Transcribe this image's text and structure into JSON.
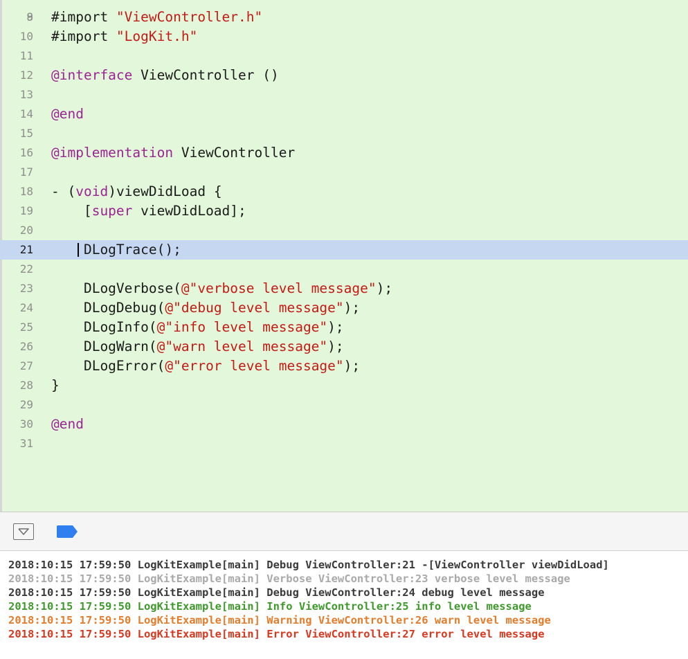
{
  "editor": {
    "top_partial_line_number": "8",
    "lines": [
      {
        "num": "9",
        "parts": [
          {
            "t": "#import ",
            "c": ""
          },
          {
            "t": "\"ViewController.h\"",
            "c": "str"
          }
        ]
      },
      {
        "num": "10",
        "parts": [
          {
            "t": "#import ",
            "c": ""
          },
          {
            "t": "\"LogKit.h\"",
            "c": "str"
          }
        ]
      },
      {
        "num": "11",
        "parts": []
      },
      {
        "num": "12",
        "parts": [
          {
            "t": "@interface",
            "c": "kw"
          },
          {
            "t": " ViewController ()",
            "c": ""
          }
        ]
      },
      {
        "num": "13",
        "parts": []
      },
      {
        "num": "14",
        "parts": [
          {
            "t": "@end",
            "c": "kw"
          }
        ]
      },
      {
        "num": "15",
        "parts": []
      },
      {
        "num": "16",
        "parts": [
          {
            "t": "@implementation",
            "c": "kw"
          },
          {
            "t": " ViewController",
            "c": ""
          }
        ]
      },
      {
        "num": "17",
        "parts": []
      },
      {
        "num": "18",
        "parts": [
          {
            "t": "- (",
            "c": ""
          },
          {
            "t": "void",
            "c": "kw"
          },
          {
            "t": ")viewDidLoad {",
            "c": ""
          }
        ]
      },
      {
        "num": "19",
        "parts": [
          {
            "t": "    [",
            "c": ""
          },
          {
            "t": "super",
            "c": "kw"
          },
          {
            "t": " viewDidLoad];",
            "c": ""
          }
        ]
      },
      {
        "num": "20",
        "parts": []
      },
      {
        "num": "21",
        "current": true,
        "parts": [
          {
            "t": "    DLogTrace();",
            "c": ""
          }
        ]
      },
      {
        "num": "22",
        "parts": []
      },
      {
        "num": "23",
        "parts": [
          {
            "t": "    DLogVerbose(",
            "c": ""
          },
          {
            "t": "@\"verbose level message\"",
            "c": "str"
          },
          {
            "t": ");",
            "c": ""
          }
        ]
      },
      {
        "num": "24",
        "parts": [
          {
            "t": "    DLogDebug(",
            "c": ""
          },
          {
            "t": "@\"debug level message\"",
            "c": "str"
          },
          {
            "t": ");",
            "c": ""
          }
        ]
      },
      {
        "num": "25",
        "parts": [
          {
            "t": "    DLogInfo(",
            "c": ""
          },
          {
            "t": "@\"info level message\"",
            "c": "str"
          },
          {
            "t": ");",
            "c": ""
          }
        ]
      },
      {
        "num": "26",
        "parts": [
          {
            "t": "    DLogWarn(",
            "c": ""
          },
          {
            "t": "@\"warn level message\"",
            "c": "str"
          },
          {
            "t": ");",
            "c": ""
          }
        ]
      },
      {
        "num": "27",
        "parts": [
          {
            "t": "    DLogError(",
            "c": ""
          },
          {
            "t": "@\"error level message\"",
            "c": "str"
          },
          {
            "t": ");",
            "c": ""
          }
        ]
      },
      {
        "num": "28",
        "parts": [
          {
            "t": "}",
            "c": ""
          }
        ]
      },
      {
        "num": "29",
        "parts": []
      },
      {
        "num": "30",
        "parts": [
          {
            "t": "@end",
            "c": "kw"
          }
        ]
      },
      {
        "num": "31",
        "parts": []
      }
    ]
  },
  "toolbar": {
    "hide_debug_area_icon": "chevron-down-box-icon",
    "breakpoints_icon": "breakpoint-tag-icon",
    "breakpoint_color": "#2f7ff0"
  },
  "console": {
    "lines": [
      {
        "level": "debug",
        "text": "2018:10:15 17:59:50 LogKitExample[main] Debug ViewController:21 -[ViewController viewDidLoad]"
      },
      {
        "level": "verbose",
        "text": "2018:10:15 17:59:50 LogKitExample[main] Verbose ViewController:23 verbose level message"
      },
      {
        "level": "debug",
        "text": "2018:10:15 17:59:50 LogKitExample[main] Debug ViewController:24 debug level message"
      },
      {
        "level": "info",
        "text": "2018:10:15 17:59:50 LogKitExample[main] Info ViewController:25 info level message"
      },
      {
        "level": "warn",
        "text": "2018:10:15 17:59:50 LogKitExample[main] Warning ViewController:26 warn level message"
      },
      {
        "level": "error",
        "text": "2018:10:15 17:59:50 LogKitExample[main] Error ViewController:27 error level message"
      }
    ]
  },
  "colors": {
    "editor_background": "#e3f8da",
    "current_line_highlight": "#c6d8f1",
    "keyword": "#9b2393",
    "string": "#c41a16",
    "log_debug": "#3a3a3a",
    "log_verbose": "#a9a9a9",
    "log_info": "#3f9a2c",
    "log_warn": "#e57c2b",
    "log_error": "#d9381e"
  }
}
